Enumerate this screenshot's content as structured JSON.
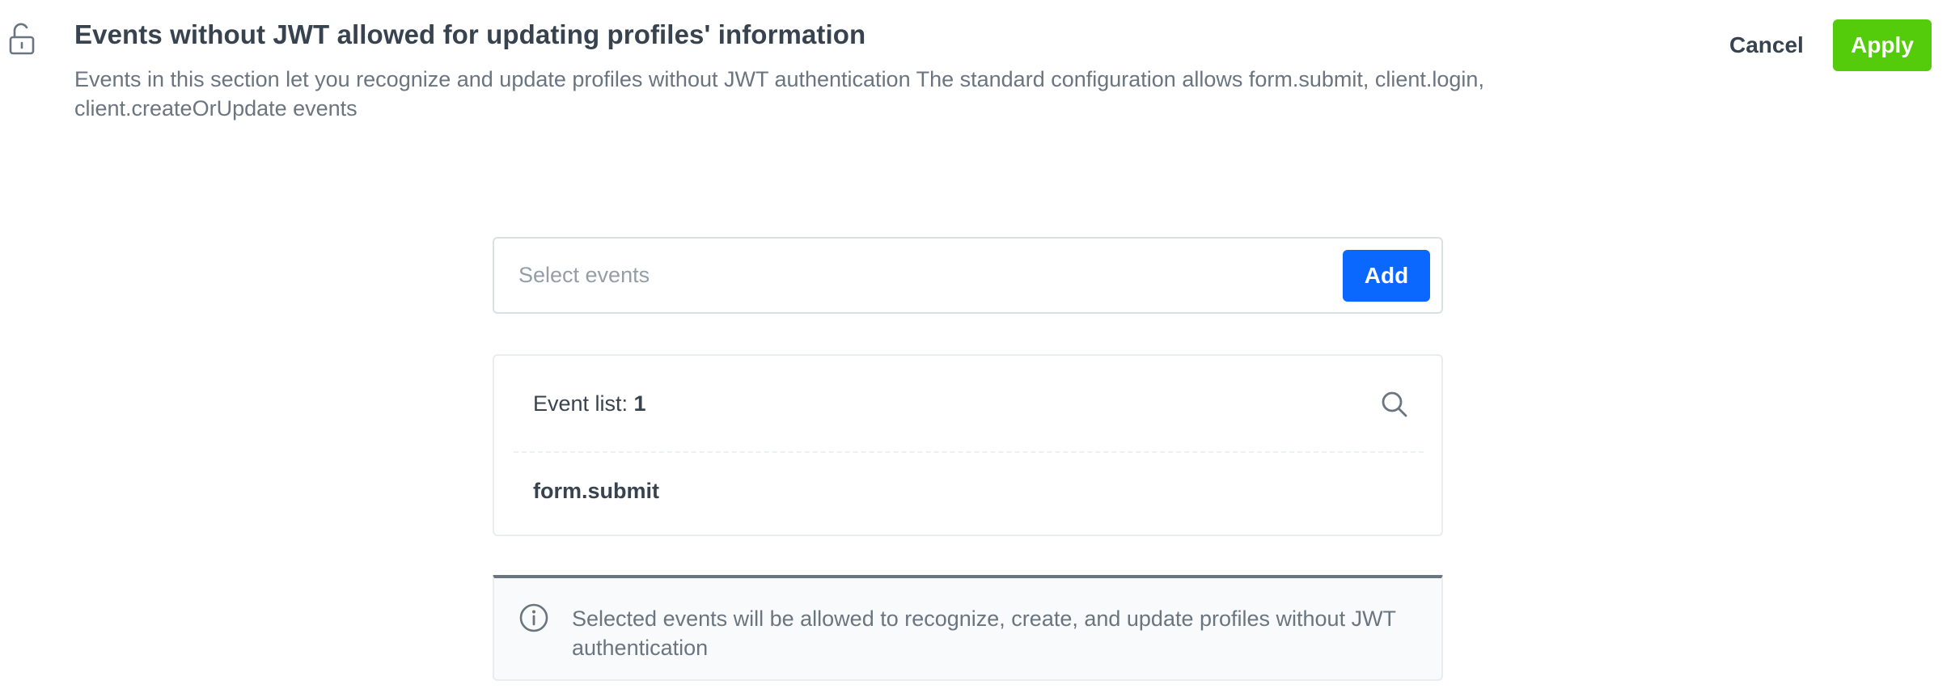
{
  "header": {
    "title": "Events without JWT allowed for updating profiles' information",
    "description": "Events in this section let you recognize and update profiles without JWT authentication The standard configuration allows form.submit, client.login, client.createOrUpdate events",
    "cancel_label": "Cancel",
    "apply_label": "Apply",
    "icon": "unlock-icon"
  },
  "select": {
    "placeholder": "Select events",
    "value": "",
    "add_label": "Add"
  },
  "event_list": {
    "label": "Event list: ",
    "count": "1",
    "search_icon": "search-icon",
    "items": [
      "form.submit"
    ]
  },
  "info": {
    "icon": "info-icon",
    "text": "Selected events will be allowed to recognize, create, and update profiles without JWT authentication"
  },
  "colors": {
    "apply": "#54cb0b",
    "add": "#0b68ff",
    "text_primary": "#384350",
    "text_secondary": "#6a7580"
  }
}
